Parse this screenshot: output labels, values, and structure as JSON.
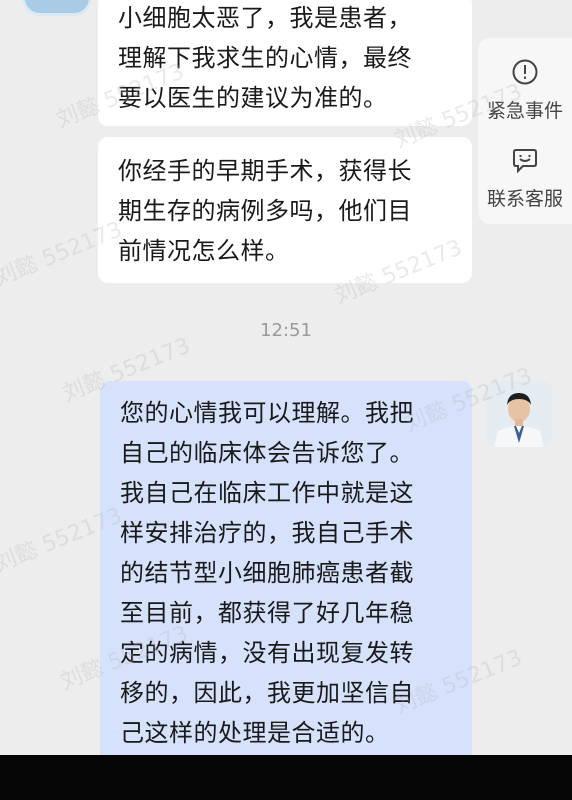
{
  "messages": [
    {
      "lines": [
        "小细胞太恶了，我是患者，",
        "理解下我求生的心情，最终",
        "要以医生的建议为准的。"
      ]
    },
    {
      "lines": [
        "你经手的早期手术，获得长",
        "期生存的病例多吗，他们目",
        "前情况怎么样。"
      ]
    },
    {
      "lines": [
        "您的心情我可以理解。我把",
        "自己的临床体会告诉您了。",
        "我自己在临床工作中就是这",
        "样安排治疗的，我自己手术",
        "的结节型小细胞肺癌患者截",
        "至目前，都获得了好几年稳",
        "定的病情，没有出现复发转",
        "移的，因此，我更加坚信自",
        "己这样的处理是合适的。"
      ]
    }
  ],
  "timestamp": "12:51",
  "side_panel": {
    "emergency": {
      "label": "紧急事件",
      "icon": "alert-circle-icon"
    },
    "service": {
      "label": "联系客服",
      "icon": "chat-service-icon"
    }
  },
  "watermarks": [
    "刘懿 552173",
    "刘懿 552173",
    "刘懿 552173",
    "刘懿 552173",
    "刘懿 552173",
    "刘懿 552173",
    "刘懿 552173",
    "刘懿 552173",
    "刘懿 552173"
  ],
  "colors": {
    "background": "#ededed",
    "doctor_bubble": "#d6e2fb",
    "patient_bubble": "#ffffff"
  }
}
